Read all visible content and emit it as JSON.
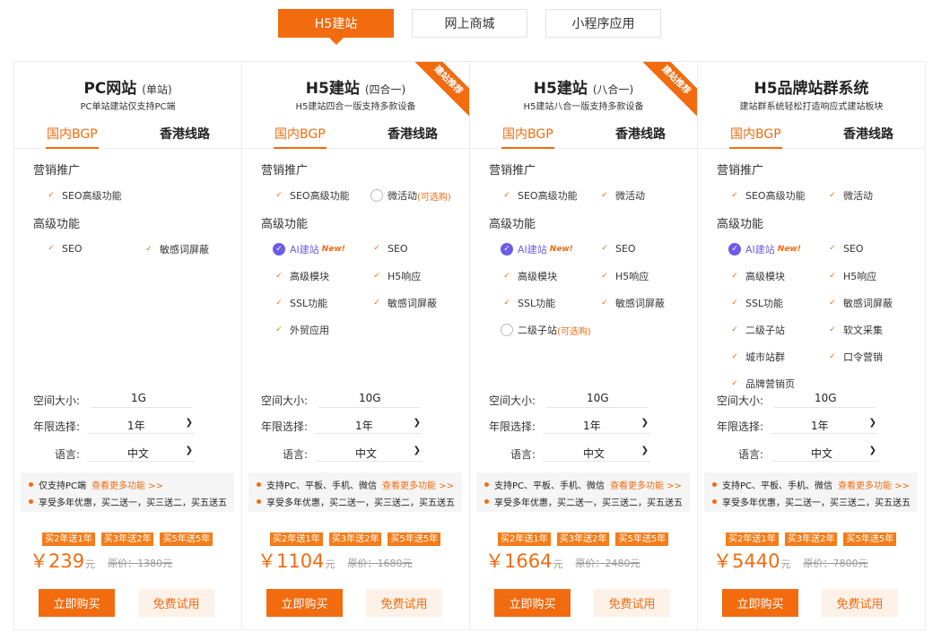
{
  "top_tabs": [
    {
      "label": "H5建站",
      "active": true
    },
    {
      "label": "网上商城",
      "active": false
    },
    {
      "label": "小程序应用",
      "active": false
    }
  ],
  "colors": {
    "accent": "#f26b0f",
    "ai": "#6c5ce7"
  },
  "labels": {
    "line_bgp": "国内BGP",
    "line_hk": "香港线路",
    "marketing": "营销推广",
    "advanced": "高级功能",
    "space": "空间大小:",
    "years": "年限选择:",
    "language": "语言:",
    "buy": "立即购买",
    "trial": "免费试用",
    "more_features": "查看更多功能 >>",
    "promo": "享受多年优惠，买二送一，买三送二，买五送五",
    "badges": [
      "买2年送1年",
      "买3年送2年",
      "买5年送5年"
    ],
    "yuan": "元",
    "currency": "￥",
    "new_tag": "New!",
    "optional": "(可选购)"
  },
  "cards": [
    {
      "title": "PC网站",
      "sub": "(单站)",
      "desc": "PC单站建站仅支持PC端",
      "ribbon": "",
      "marketing": [
        {
          "label": "SEO高级功能",
          "type": "check"
        }
      ],
      "advanced": [
        {
          "label": "SEO",
          "type": "check"
        },
        {
          "label": "敏感词屏蔽",
          "type": "check"
        }
      ],
      "space": "1G",
      "years": "1年",
      "language": "中文",
      "support": "仅支持PC端",
      "price": "239",
      "orig": "原价：1380元"
    },
    {
      "title": "H5建站",
      "sub": "(四合一)",
      "desc": "H5建站四合一版支持多款设备",
      "ribbon": "建站推荐",
      "marketing": [
        {
          "label": "SEO高级功能",
          "type": "check"
        },
        {
          "label": "微活动",
          "type": "empty",
          "optional": true
        }
      ],
      "advanced": [
        {
          "label": "AI建站",
          "type": "ai"
        },
        {
          "label": "SEO",
          "type": "check"
        },
        {
          "label": "高级模块",
          "type": "check"
        },
        {
          "label": "H5响应",
          "type": "check"
        },
        {
          "label": "SSL功能",
          "type": "check"
        },
        {
          "label": "敏感词屏蔽",
          "type": "check"
        },
        {
          "label": "外贸应用",
          "type": "check"
        }
      ],
      "space": "10G",
      "years": "1年",
      "language": "中文",
      "support": "支持PC、平板、手机、微信",
      "price": "1104",
      "orig": "原价：1680元"
    },
    {
      "title": "H5建站",
      "sub": "(八合一)",
      "desc": "H5建站八合一版支持多款设备",
      "ribbon": "建站推荐",
      "marketing": [
        {
          "label": "SEO高级功能",
          "type": "check"
        },
        {
          "label": "微活动",
          "type": "check"
        }
      ],
      "advanced": [
        {
          "label": "AI建站",
          "type": "ai"
        },
        {
          "label": "SEO",
          "type": "check"
        },
        {
          "label": "高级模块",
          "type": "check"
        },
        {
          "label": "H5响应",
          "type": "check"
        },
        {
          "label": "SSL功能",
          "type": "check"
        },
        {
          "label": "敏感词屏蔽",
          "type": "check"
        },
        {
          "label": "二级子站",
          "type": "empty",
          "optional": true
        }
      ],
      "space": "10G",
      "years": "1年",
      "language": "中文",
      "support": "支持PC、平板、手机、微信",
      "price": "1664",
      "orig": "原价：2480元"
    },
    {
      "title": "H5品牌站群系统",
      "sub": "",
      "desc": "建站群系统轻松打造响应式建站板块",
      "ribbon": "",
      "marketing": [
        {
          "label": "SEO高级功能",
          "type": "check"
        },
        {
          "label": "微活动",
          "type": "check"
        }
      ],
      "advanced": [
        {
          "label": "AI建站",
          "type": "ai"
        },
        {
          "label": "SEO",
          "type": "check"
        },
        {
          "label": "高级模块",
          "type": "check"
        },
        {
          "label": "H5响应",
          "type": "check"
        },
        {
          "label": "SSL功能",
          "type": "check"
        },
        {
          "label": "敏感词屏蔽",
          "type": "check"
        },
        {
          "label": "二级子站",
          "type": "check"
        },
        {
          "label": "软文采集",
          "type": "check"
        },
        {
          "label": "城市站群",
          "type": "check"
        },
        {
          "label": "口令营销",
          "type": "check"
        },
        {
          "label": "品牌营销页",
          "type": "check"
        }
      ],
      "space": "10G",
      "years": "1年",
      "language": "中文",
      "support": "支持PC、平板、手机、微信",
      "price": "5440",
      "orig": "原价：7800元"
    }
  ]
}
